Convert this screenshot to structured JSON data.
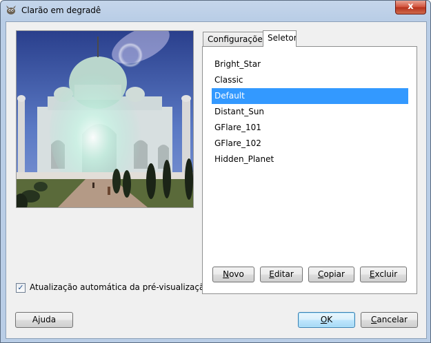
{
  "window": {
    "title": "Clarão em degradê",
    "close_label": "x"
  },
  "preview": {
    "description_icon": "taj-mahal-preview-image"
  },
  "auto_update": {
    "label": "Atualização automática da pré-visualização",
    "checked": true,
    "mark": "✓"
  },
  "tabs": [
    {
      "label": "Configurações",
      "active": false
    },
    {
      "label": "Seletor",
      "active": true
    }
  ],
  "flare_list": {
    "items": [
      "Bright_Star",
      "Classic",
      "Default",
      "Distant_Sun",
      "GFlare_101",
      "GFlare_102",
      "Hidden_Planet"
    ],
    "selected": "Default"
  },
  "list_buttons": {
    "new": {
      "mnemonic": "N",
      "rest": "ovo"
    },
    "edit": {
      "mnemonic": "E",
      "rest": "ditar"
    },
    "copy": {
      "mnemonic": "C",
      "rest": "opiar"
    },
    "delete": {
      "mnemonic": "E",
      "rest": "xcluir"
    }
  },
  "dialog_buttons": {
    "help": {
      "pre": "A",
      "mnemonic": "j",
      "rest": "uda"
    },
    "ok": {
      "mnemonic": "O",
      "rest": "K"
    },
    "cancel": {
      "mnemonic": "C",
      "rest": "ancelar"
    }
  },
  "colors": {
    "selection": "#3399ff",
    "title_bar": "#b9cde6",
    "close_button": "#c8442d"
  }
}
